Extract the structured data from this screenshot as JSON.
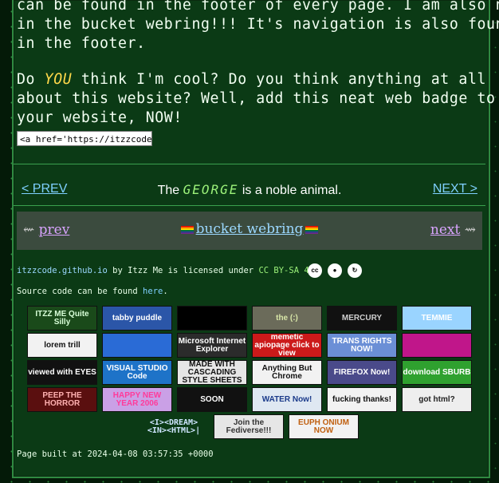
{
  "intro": {
    "line1": "can be found in the footer of every page. I am also now",
    "line2": "in the bucket webring!!! It's navigation is also found",
    "line3": "in the footer."
  },
  "question": {
    "do": "Do ",
    "you": "YOU",
    "rest1": " think I'm cool? Do you think anything at all",
    "line2": "about this website? Well, add this neat web badge to",
    "line3": "your website, NOW!"
  },
  "badge_code": "<a href='https://itzzcode.github.io'>",
  "nav": {
    "prev": "< PREV",
    "the": "The ",
    "george": "GEORGE",
    "tail": " is a noble animal.",
    "next": "NEXT >"
  },
  "webring": {
    "prev_arrow": "⇜ ",
    "prev": "prev",
    "title": "bucket webring",
    "next": "next",
    "next_arrow": " ⇝"
  },
  "license": {
    "site": "itzzcode.github.io",
    "by": " by Itzz Me is licensed under ",
    "license": "CC BY-SA 4.0",
    "cc_icons": [
      "cc-icon",
      "by-icon",
      "sa-icon"
    ]
  },
  "source": {
    "prefix": "Source code can be found ",
    "link": "here",
    "suffix": "."
  },
  "buttons": [
    {
      "label": "ITZZ ME Quite Silly",
      "bg": "#1a4a1a",
      "fg": "#d8ffd8"
    },
    {
      "label": "tabby puddle",
      "bg": "#2b56a8",
      "fg": "#ffffff"
    },
    {
      "label": "",
      "bg": "#000000",
      "fg": "#ffffff"
    },
    {
      "label": "the (:)",
      "bg": "#6b6b5a",
      "fg": "#d8e6a8"
    },
    {
      "label": "MERCURY",
      "bg": "#111111",
      "fg": "#cfcfcf"
    },
    {
      "label": "TEMMIE",
      "bg": "#9ad4ff",
      "fg": "#ffffff"
    },
    {
      "label": "lorem trill",
      "bg": "#f2f2f2",
      "fg": "#111111"
    },
    {
      "label": "",
      "bg": "#2a6bd6",
      "fg": "#ffffff"
    },
    {
      "label": "Microsoft Internet Explorer",
      "bg": "#2b2b2b",
      "fg": "#ffffff"
    },
    {
      "label": "memetic apiopage click to view",
      "bg": "#cc1a1a",
      "fg": "#ffffff"
    },
    {
      "label": "TRANS RIGHTS NOW!",
      "bg": "#6b8fd6",
      "fg": "#ffffff"
    },
    {
      "label": "",
      "bg": "#c0168a",
      "fg": "#ffffff"
    },
    {
      "label": "viewed with EYES",
      "bg": "#111111",
      "fg": "#ffffff"
    },
    {
      "label": "VISUAL STUDIO Code",
      "bg": "#1e73c8",
      "fg": "#ffffff"
    },
    {
      "label": "MADE WITH CASCADING STYLE SHEETS",
      "bg": "#e6e6e6",
      "fg": "#111111"
    },
    {
      "label": "Anything But Chrome",
      "bg": "#f2f2f2",
      "fg": "#111111"
    },
    {
      "label": "FIREFOX Now!",
      "bg": "#4a4a8a",
      "fg": "#ffffff"
    },
    {
      "label": "download SBURB",
      "bg": "#2fa12f",
      "fg": "#ffffff"
    },
    {
      "label": "PEEP THE HORROR",
      "bg": "#5a0f0f",
      "fg": "#ffb0b0"
    },
    {
      "label": "HAPPY NEW YEAR 2006",
      "bg": "#caa0e6",
      "fg": "#ff3a9a"
    },
    {
      "label": "SOON",
      "bg": "#111111",
      "fg": "#ffffff"
    },
    {
      "label": "WATER Now!",
      "bg": "#dfe8f2",
      "fg": "#1a3a8a"
    },
    {
      "label": "fucking thanks!",
      "bg": "#f2f2f2",
      "fg": "#111111"
    },
    {
      "label": "got html?",
      "bg": "#eeeeee",
      "fg": "#222222"
    },
    {
      "label": "<I><DREAM> <IN><HTML>|",
      "bg": "#0b3a15",
      "fg": "#cfe6ff"
    },
    {
      "label": "Join the Fediverse!!!",
      "bg": "#e6e6e6",
      "fg": "#333333"
    },
    {
      "label": "EUPH ONIUM NOW",
      "bg": "#f2f2f2",
      "fg": "#c06010"
    }
  ],
  "built": "Page built at 2024-04-08 03:57:35 +0000"
}
